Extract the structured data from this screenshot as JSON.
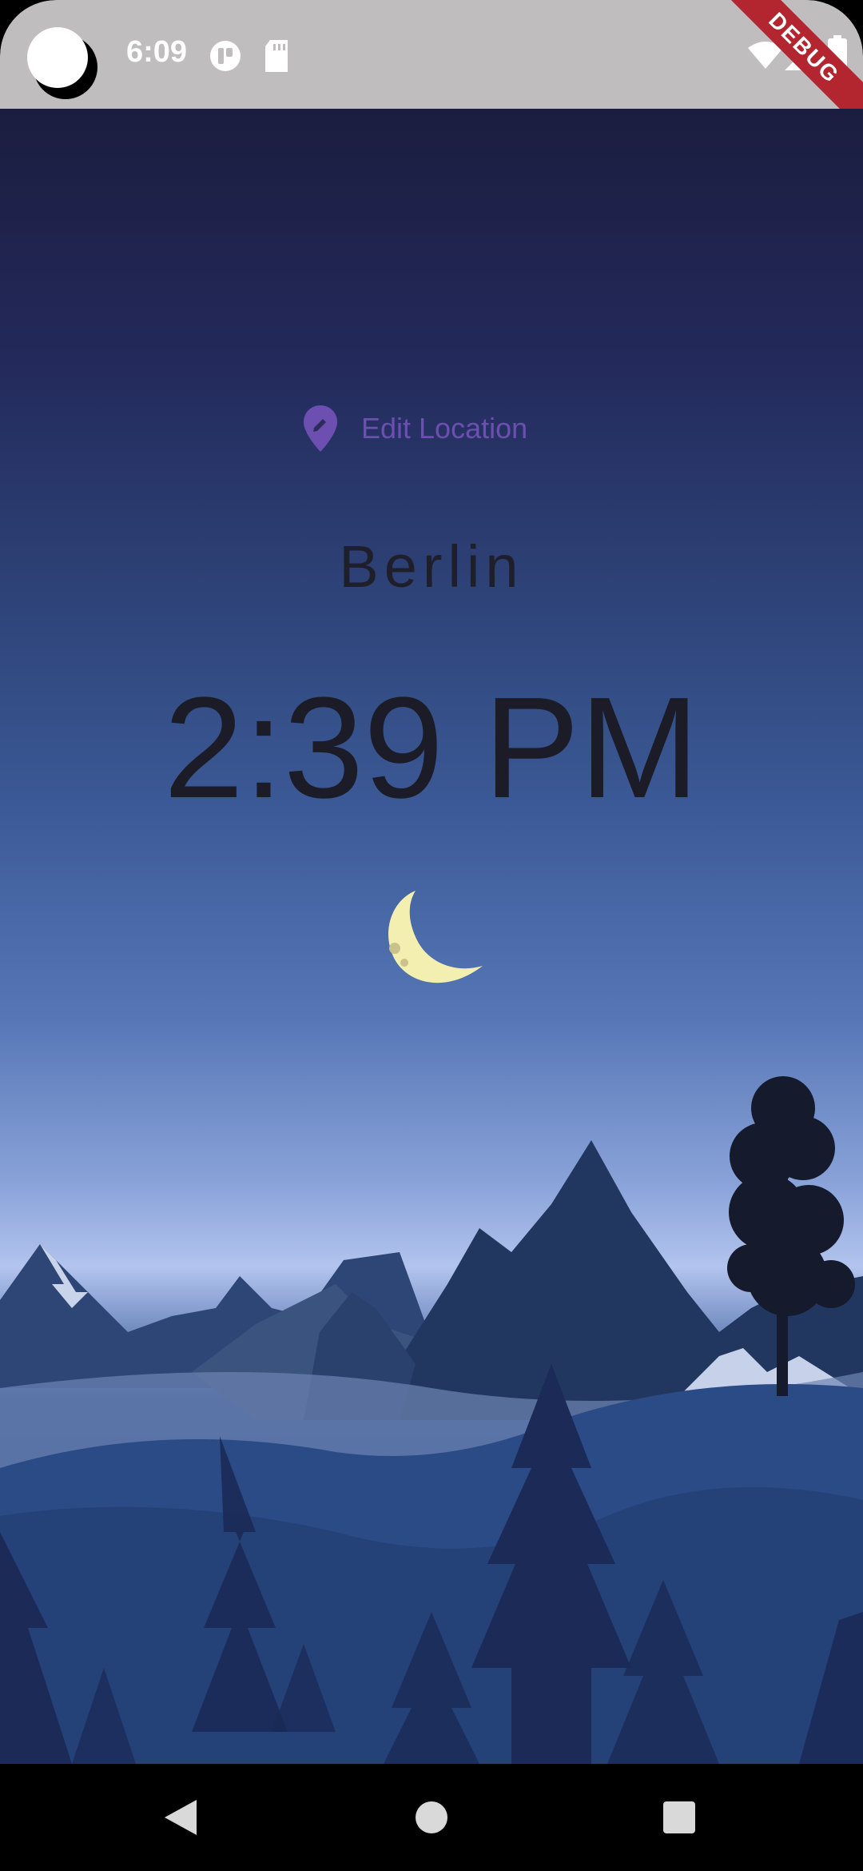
{
  "status_bar": {
    "time": "6:09",
    "debug_label": "DEBUG"
  },
  "location": {
    "edit_label": "Edit Location",
    "city": "Berlin",
    "time": "2:39 PM",
    "daytime_icon": "moon-icon"
  },
  "colors": {
    "status_bar_bg": "#bfbdbe",
    "accent": "#6c4fb0",
    "text_dark": "#1b1c27",
    "sky_top": "#1b1d3f",
    "sky_horizon": "#b2c4ee",
    "debug_banner": "#b3262f"
  },
  "nav": {
    "back": "back-icon",
    "home": "home-icon",
    "recents": "recents-icon"
  }
}
